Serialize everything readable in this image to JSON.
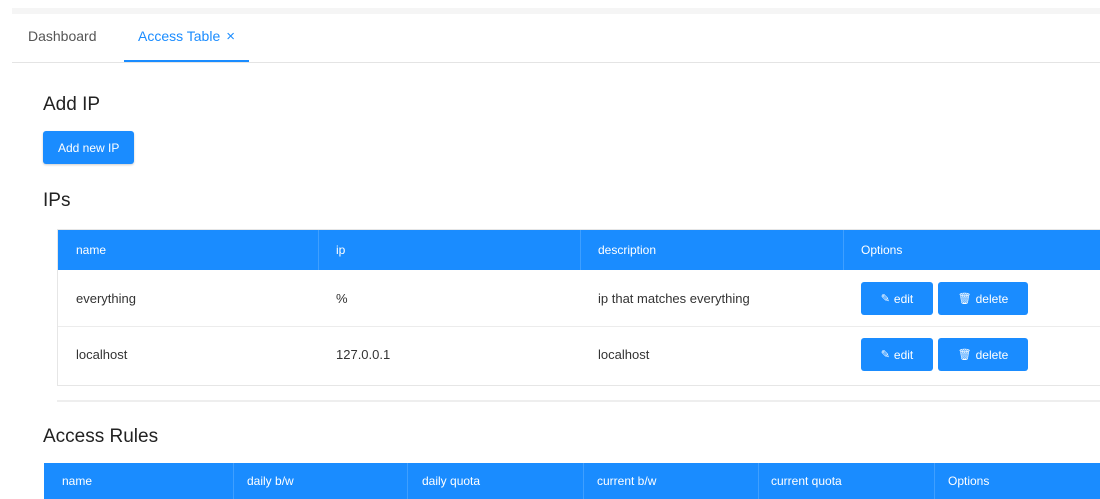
{
  "tabs": [
    {
      "label": "Dashboard"
    },
    {
      "label": "Access Table",
      "close_glyph": "×"
    }
  ],
  "add_ip": {
    "heading": "Add IP",
    "button_label": "Add new IP"
  },
  "ips": {
    "heading": "IPs",
    "columns": [
      "name",
      "ip",
      "description",
      "Options"
    ],
    "rows": [
      {
        "name": "everything",
        "ip": "%",
        "description": "ip that matches everything"
      },
      {
        "name": "localhost",
        "ip": "127.0.0.1",
        "description": "localhost"
      }
    ],
    "edit_label": "edit",
    "delete_label": "delete",
    "edit_icon": "pencil-icon",
    "delete_icon": "trash-icon"
  },
  "access_rules": {
    "heading": "Access Rules",
    "columns": [
      "name",
      "daily b/w",
      "daily quota",
      "current b/w",
      "current quota",
      "Options"
    ]
  },
  "colors": {
    "accent": "#1a8cff",
    "header_text": "#ffffff"
  }
}
